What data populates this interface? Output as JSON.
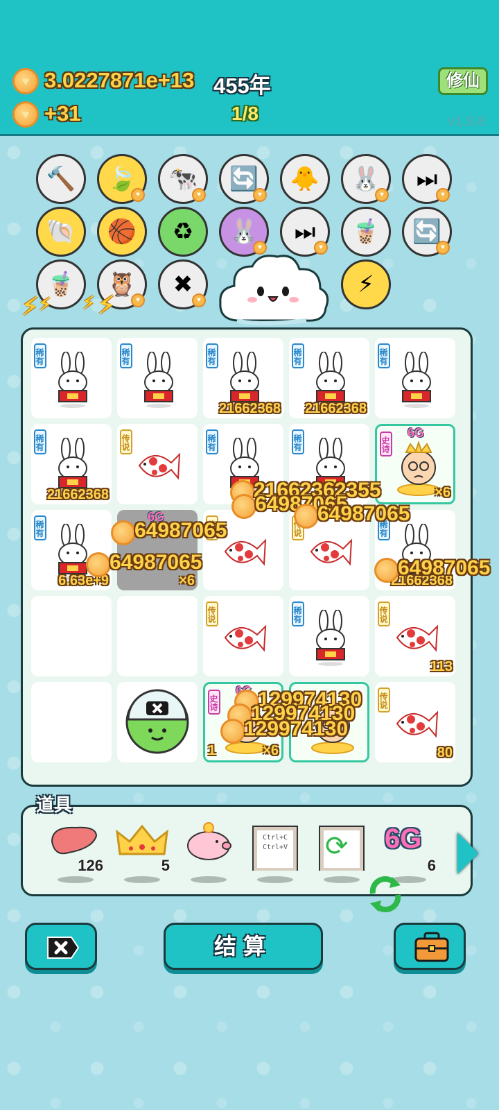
{
  "header": {
    "coins": "3.0227871e+13",
    "years": "455年",
    "income": "+31",
    "page": "1/8",
    "cultivate_label": "修仙",
    "version": "v1.9.8"
  },
  "skills": [
    {
      "name": "hammer-icon"
    },
    {
      "name": "leaf-icon"
    },
    {
      "name": "cows-icon"
    },
    {
      "name": "refresh-icon"
    },
    {
      "name": "chick-icon"
    },
    {
      "name": "rabbit-icon"
    },
    {
      "name": "skip-icon"
    },
    {
      "name": "shell-icon"
    },
    {
      "name": "basketballs-icon"
    },
    {
      "name": "recycle-icon"
    },
    {
      "name": "rabbit-icon"
    },
    {
      "name": "skip-icon"
    },
    {
      "name": "bubble-tea-icon"
    },
    {
      "name": "refresh-icon"
    },
    {
      "name": "bubble-tea-icon"
    },
    {
      "name": "owl-icon"
    },
    {
      "name": "ad-icon"
    },
    {
      "name": "lightning-icon"
    }
  ],
  "tags": {
    "rare": "稀有",
    "legend": "传说",
    "epic": "史诗"
  },
  "board": {
    "cells": [
      {
        "item": "rabbit",
        "tag": "rare",
        "value": ""
      },
      {
        "item": "rabbit",
        "tag": "rare",
        "value": ""
      },
      {
        "item": "rabbit",
        "tag": "rare",
        "value": "21662368"
      },
      {
        "item": "rabbit",
        "tag": "rare",
        "value": "21662368"
      },
      {
        "item": "rabbit",
        "tag": "rare",
        "value": ""
      },
      {
        "item": "rabbit",
        "tag": "rare",
        "value": "21662368"
      },
      {
        "item": "fish",
        "tag": "legend",
        "value": ""
      },
      {
        "item": "rabbit",
        "tag": "rare",
        "value": ""
      },
      {
        "item": "rabbit",
        "tag": "rare",
        "value": ""
      },
      {
        "item": "old-man",
        "tag": "epic",
        "value": "×6",
        "badge": "6G"
      },
      {
        "item": "rabbit",
        "tag": "rare",
        "value": "6.63e+9"
      },
      {
        "item": "dark",
        "tag": "",
        "value": "×6",
        "badge": "6G"
      },
      {
        "item": "fish",
        "tag": "legend",
        "value": ""
      },
      {
        "item": "fish",
        "tag": "legend",
        "value": ""
      },
      {
        "item": "rabbit",
        "tag": "rare",
        "value": "21662368"
      },
      {
        "item": "empty",
        "tag": "",
        "value": ""
      },
      {
        "item": "empty",
        "tag": "",
        "value": ""
      },
      {
        "item": "fish",
        "tag": "legend",
        "value": ""
      },
      {
        "item": "rabbit",
        "tag": "rare",
        "value": ""
      },
      {
        "item": "fish",
        "tag": "legend",
        "value": "113"
      },
      {
        "item": "empty",
        "tag": "",
        "value": ""
      },
      {
        "item": "capsule",
        "tag": "",
        "value": ""
      },
      {
        "item": "old-man",
        "tag": "epic",
        "value": "×6",
        "badge": "6G",
        "value_left": "1"
      },
      {
        "item": "old-man",
        "tag": "",
        "value": ""
      },
      {
        "item": "fish",
        "tag": "legend",
        "value": "80"
      }
    ],
    "floats": [
      "21662362355",
      "64987065",
      "64987065",
      "64987065",
      "64987065",
      "64987065",
      "129974130",
      "129974130",
      "129974130"
    ]
  },
  "tools": {
    "label": "道具",
    "items": [
      {
        "name": "liver-icon",
        "count": "126"
      },
      {
        "name": "crown-icon",
        "count": "5"
      },
      {
        "name": "piggy-bank-icon",
        "count": ""
      },
      {
        "name": "copy-paste-icon",
        "count": "",
        "text": "Ctrl+C Ctrl+V"
      },
      {
        "name": "frame-refresh-icon",
        "count": ""
      },
      {
        "name": "6g-icon",
        "count": "6",
        "text": "6G"
      }
    ]
  },
  "bottom": {
    "settle_label": "结算"
  },
  "colors": {
    "header": "#1fc3c6",
    "background": "#a6dde6",
    "gold_text": "#ffd24a",
    "rare": "#2b88c9",
    "legend": "#d4a12a",
    "epic": "#c93ba6"
  }
}
